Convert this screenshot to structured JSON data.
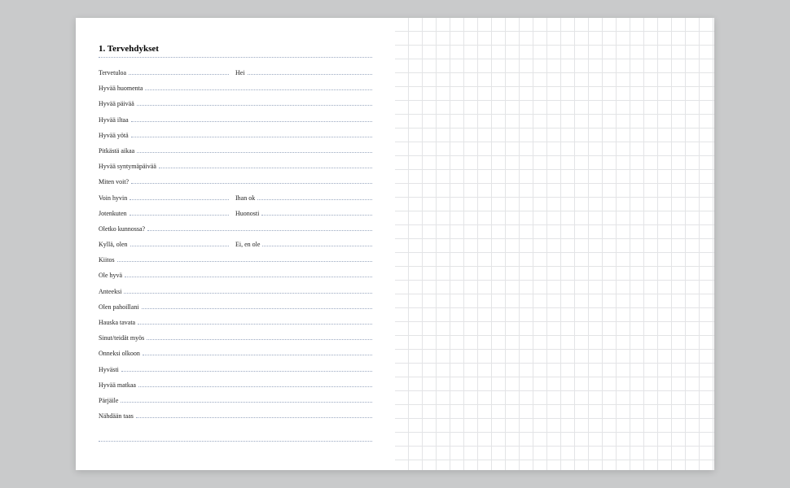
{
  "heading": "1. Tervehdykset",
  "rows": [
    {
      "type": "split",
      "left": "Tervetuloa",
      "right": "Hei"
    },
    {
      "type": "full",
      "text": "Hyvää huomenta"
    },
    {
      "type": "full",
      "text": "Hyvää päivää"
    },
    {
      "type": "full",
      "text": "Hyvää iltaa"
    },
    {
      "type": "full",
      "text": "Hyvää yötä"
    },
    {
      "type": "full",
      "text": "Pitkästä aikaa"
    },
    {
      "type": "full",
      "text": "Hyvää syntymäpäivää"
    },
    {
      "type": "full",
      "text": "Miten voit?"
    },
    {
      "type": "split",
      "left": "Voin hyvin",
      "right": "Ihan ok"
    },
    {
      "type": "split",
      "left": "Jotenkuten",
      "right": "Huonosti"
    },
    {
      "type": "full",
      "text": "Oletko kunnossa?"
    },
    {
      "type": "split",
      "left": "Kyllä, olen",
      "right": "Ei, en ole"
    },
    {
      "type": "full",
      "text": "Kiitos"
    },
    {
      "type": "full",
      "text": "Ole hyvä"
    },
    {
      "type": "full",
      "text": "Anteeksi"
    },
    {
      "type": "full",
      "text": "Olen pahoillani"
    },
    {
      "type": "full",
      "text": "Hauska tavata"
    },
    {
      "type": "full",
      "text": "Sinut/teidät myös"
    },
    {
      "type": "full",
      "text": "Onneksi olkoon"
    },
    {
      "type": "full",
      "text": "Hyvästi"
    },
    {
      "type": "full",
      "text": "Hyvää matkaa"
    },
    {
      "type": "full",
      "text": "Pärjäile"
    },
    {
      "type": "full",
      "text": "Nähdään taas"
    }
  ]
}
